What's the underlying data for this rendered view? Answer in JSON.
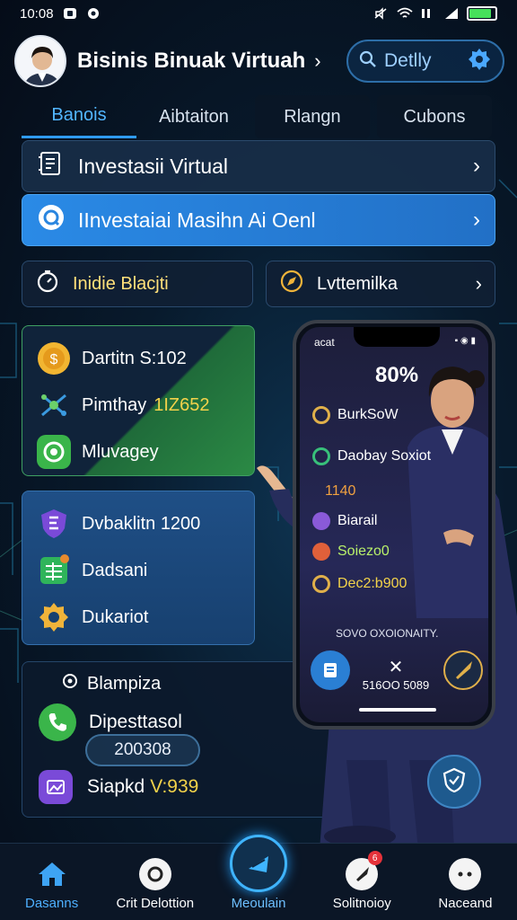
{
  "status": {
    "time": "10:08"
  },
  "header": {
    "title": "Bisinis Binuak Virtuah",
    "search_placeholder": "Detlly"
  },
  "tabs": [
    {
      "label": "Banois",
      "active": true
    },
    {
      "label": "Aibtaiton"
    },
    {
      "label": "Rlangn"
    },
    {
      "label": "Cubons"
    }
  ],
  "rows": [
    {
      "label": "Investasii Virtual"
    },
    {
      "label": "IInvestaiai Masihn Ai Oenl"
    }
  ],
  "quick": [
    {
      "label": "Inidie Blacjti"
    },
    {
      "label": "Lvttemilka"
    }
  ],
  "card_green": {
    "items": [
      {
        "label": "Dartitn S:102"
      },
      {
        "label": "Pimthay",
        "value": "1IZ652"
      },
      {
        "label": "Mluvagey"
      }
    ]
  },
  "card_blue": {
    "items": [
      {
        "label": "Dvbaklitn 1200"
      },
      {
        "label": "Dadsani"
      },
      {
        "label": "Dukariot"
      }
    ]
  },
  "card_dark": {
    "title": "Blampiza",
    "item1": "Dipesttasol",
    "pill": "200308",
    "item2_label": "Siapkd",
    "item2_value": "V:939"
  },
  "phone": {
    "time": "acat",
    "percent": "80%",
    "items": [
      {
        "label": "BurkSoW",
        "color": "#e0b04a"
      },
      {
        "label": "Daobay Soxiot",
        "color": "#38c07a"
      },
      {
        "label": "1140",
        "color": "#f0a040"
      },
      {
        "label": "Biarail",
        "color": "#8a5ad8"
      },
      {
        "label": "Soiezo0",
        "color": "#e0603a"
      },
      {
        "label": "Dec2:b900",
        "color": "#e0b04a"
      }
    ],
    "footer": "SOVO OXOIONAITY.",
    "mid_label": "516OO 5089"
  },
  "nav": [
    {
      "label": "Dasanns",
      "icon": "home-icon",
      "active": true
    },
    {
      "label": "Crit Delottion",
      "icon": "camera-icon"
    },
    {
      "label": "Meoulain",
      "icon": "chart-icon",
      "center": true
    },
    {
      "label": "Solitnoioy",
      "icon": "rocket-icon",
      "badge": "6"
    },
    {
      "label": "Naceand",
      "icon": "more-icon"
    }
  ],
  "colors": {
    "accent": "#2f9bf0",
    "gold": "#f2d24a",
    "green": "#3fa062"
  }
}
